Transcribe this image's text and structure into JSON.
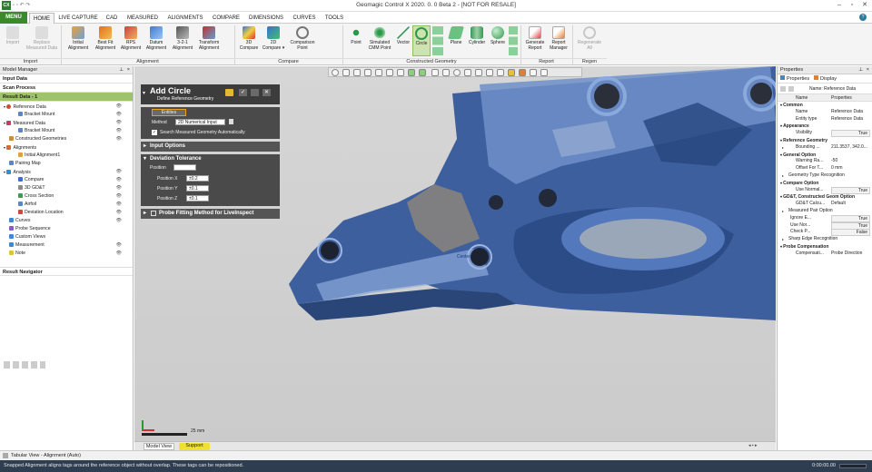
{
  "app": {
    "title": "Geomagic Control X 2020. 0. 0 Beta 2 - [NOT FOR RESALE]",
    "logo": "CX"
  },
  "tabs": [
    "MENU",
    "HOME",
    "LIVE CAPTURE",
    "CAD",
    "MEASURED",
    "ALIGNMENTS",
    "COMPARE",
    "DIMENSIONS",
    "CURVES",
    "TOOLS"
  ],
  "ribbon": {
    "buttons": [
      {
        "label": "Import",
        "label2": "",
        "icon": "import-icon",
        "disabled": true
      },
      {
        "label": "Replace",
        "label2": "Measured Data",
        "icon": "replace-icon",
        "disabled": true
      },
      {
        "label": "Initial",
        "label2": "Alignment",
        "icon": "initial-alignment-icon"
      },
      {
        "label": "Best Fit",
        "label2": "Alignment",
        "icon": "best-fit-icon"
      },
      {
        "label": "RPS",
        "label2": "Alignment",
        "icon": "rps-icon"
      },
      {
        "label": "Datum",
        "label2": "Alignment",
        "icon": "datum-icon"
      },
      {
        "label": "3-2-1",
        "label2": "Alignment",
        "icon": "321-icon"
      },
      {
        "label": "Transform",
        "label2": "Alignment",
        "icon": "transform-icon"
      },
      {
        "label": "3D",
        "label2": "Compare",
        "icon": "3d-compare-icon"
      },
      {
        "label": "2D",
        "label2": "Compare ▾",
        "icon": "2d-compare-icon"
      },
      {
        "label": "Comparison",
        "label2": "Point",
        "icon": "comparison-point-icon"
      },
      {
        "label": "Point",
        "label2": "",
        "icon": "point-icon"
      },
      {
        "label": "Simulated",
        "label2": "CMM Point",
        "icon": "cmm-point-icon"
      },
      {
        "label": "Vector",
        "label2": "",
        "icon": "vector-icon"
      },
      {
        "label": "Circle",
        "label2": "",
        "icon": "circle-icon",
        "active": true
      },
      {
        "label": "Plane",
        "label2": "",
        "icon": "plane-icon"
      },
      {
        "label": "Cylinder",
        "label2": "",
        "icon": "cylinder-icon"
      },
      {
        "label": "Sphere",
        "label2": "",
        "icon": "sphere-icon"
      },
      {
        "label": "Generate",
        "label2": "Report",
        "icon": "generate-report-icon"
      },
      {
        "label": "Report",
        "label2": "Manager",
        "icon": "report-manager-icon"
      },
      {
        "label": "Regenerate",
        "label2": "All",
        "icon": "regenerate-icon",
        "disabled": true
      }
    ],
    "groups": [
      "Import",
      "Alignment",
      "Compare",
      "Constructed Geometry",
      "Report",
      "Regen"
    ]
  },
  "model_manager": {
    "title": "Model Manager",
    "input_data": "Input Data",
    "scan_process": "Scan Process",
    "result_data": "Result Data - 1",
    "items": [
      {
        "label": "Reference Data",
        "level": 0
      },
      {
        "label": "Bracket Mount",
        "level": 1
      },
      {
        "label": "Measured Data",
        "level": 0
      },
      {
        "label": "Bracket Mount",
        "level": 1
      },
      {
        "label": "Constructed Geometries",
        "level": 0
      },
      {
        "label": "Alignments",
        "level": 0
      },
      {
        "label": "Initial Alignment1",
        "level": 1
      },
      {
        "label": "Pairing Map",
        "level": 0
      },
      {
        "label": "Analysis",
        "level": 0
      },
      {
        "label": "Compare",
        "level": 1
      },
      {
        "label": "3D GD&T",
        "level": 1
      },
      {
        "label": "Cross Section",
        "level": 1
      },
      {
        "label": "Airfoil",
        "level": 1
      },
      {
        "label": "Deviation Location",
        "level": 1
      },
      {
        "label": "Curves",
        "level": 0
      },
      {
        "label": "Probe Sequence",
        "level": 0
      },
      {
        "label": "Custom Views",
        "level": 0
      },
      {
        "label": "Measurement",
        "level": 0
      },
      {
        "label": "Note",
        "level": 0
      }
    ],
    "navigator": "Result Navigator"
  },
  "dialog": {
    "title": "Add Circle",
    "subtitle": "Define Reference Geometry",
    "entities_tab": "Entities",
    "method_label": "Method",
    "method_value": "2D Numerical Input",
    "search_label": "Search Measured Geometry Automatically",
    "input_options": "Input Options",
    "deviation_tolerance": "Deviation Tolerance",
    "position_label": "Position",
    "px_label": "Position X",
    "px_value": "±0.2",
    "py_label": "Position Y",
    "py_value": "±0.1",
    "pz_label": "Position Z",
    "pz_value": "±0.1",
    "probe_fitting": "Probe Fitting Method for LiveInspect"
  },
  "viewport": {
    "center_label": "Center",
    "axis_label": "25 mm"
  },
  "bottom_tabs": [
    "Model View",
    "Support"
  ],
  "tabular": "Tabular View - Alignment (Auto)",
  "status": {
    "text": "Snapped Alignment aligns tags around the reference object without overlap. These tags can be repositioned.",
    "time": "0:00:00.00"
  },
  "properties": {
    "title": "Properties",
    "tabs": [
      "Properties",
      "Display"
    ],
    "name_row": "Name: Reference Data",
    "col_name": "Name",
    "col_props": "Properties",
    "rows": [
      {
        "cat": "Common"
      },
      {
        "k": "Name",
        "v": "Reference Data"
      },
      {
        "k": "Entity type",
        "v": "Reference Data"
      },
      {
        "cat": "Appearance"
      },
      {
        "k": "Visibility",
        "v": "True",
        "box": true
      },
      {
        "cat": "Reference Geometry"
      },
      {
        "k": "Bounding ...",
        "v": "211.3537, 342.0...",
        "tw": true
      },
      {
        "cat": "General Option"
      },
      {
        "k": "Warning Ra...",
        "v": "-50"
      },
      {
        "k": "Offset For T...",
        "v": "0 mm"
      },
      {
        "k": "Geometry Type Recognition",
        "v": "",
        "tw": true
      },
      {
        "cat": "Compare Option"
      },
      {
        "k": "Use Normal...",
        "v": "True",
        "box": true
      },
      {
        "cat": "GD&T, Constructed Geom Option"
      },
      {
        "k": "GD&T Calcu...",
        "v": "Default"
      },
      {
        "k": "Measured Pair Option",
        "v": "",
        "tw": true
      },
      {
        "k": "Ignore E...",
        "v": "True",
        "box": true,
        "sub": true
      },
      {
        "k": "Use Nor...",
        "v": "True",
        "box": true,
        "sub": true
      },
      {
        "k": "Check P...",
        "v": "False",
        "box": true,
        "sub": true
      },
      {
        "k": "Sharp Edge Recognition",
        "v": "",
        "tw": true
      },
      {
        "cat": "Probe Compensation"
      },
      {
        "k": "Compensati...",
        "v": "Probe Direction"
      }
    ]
  }
}
